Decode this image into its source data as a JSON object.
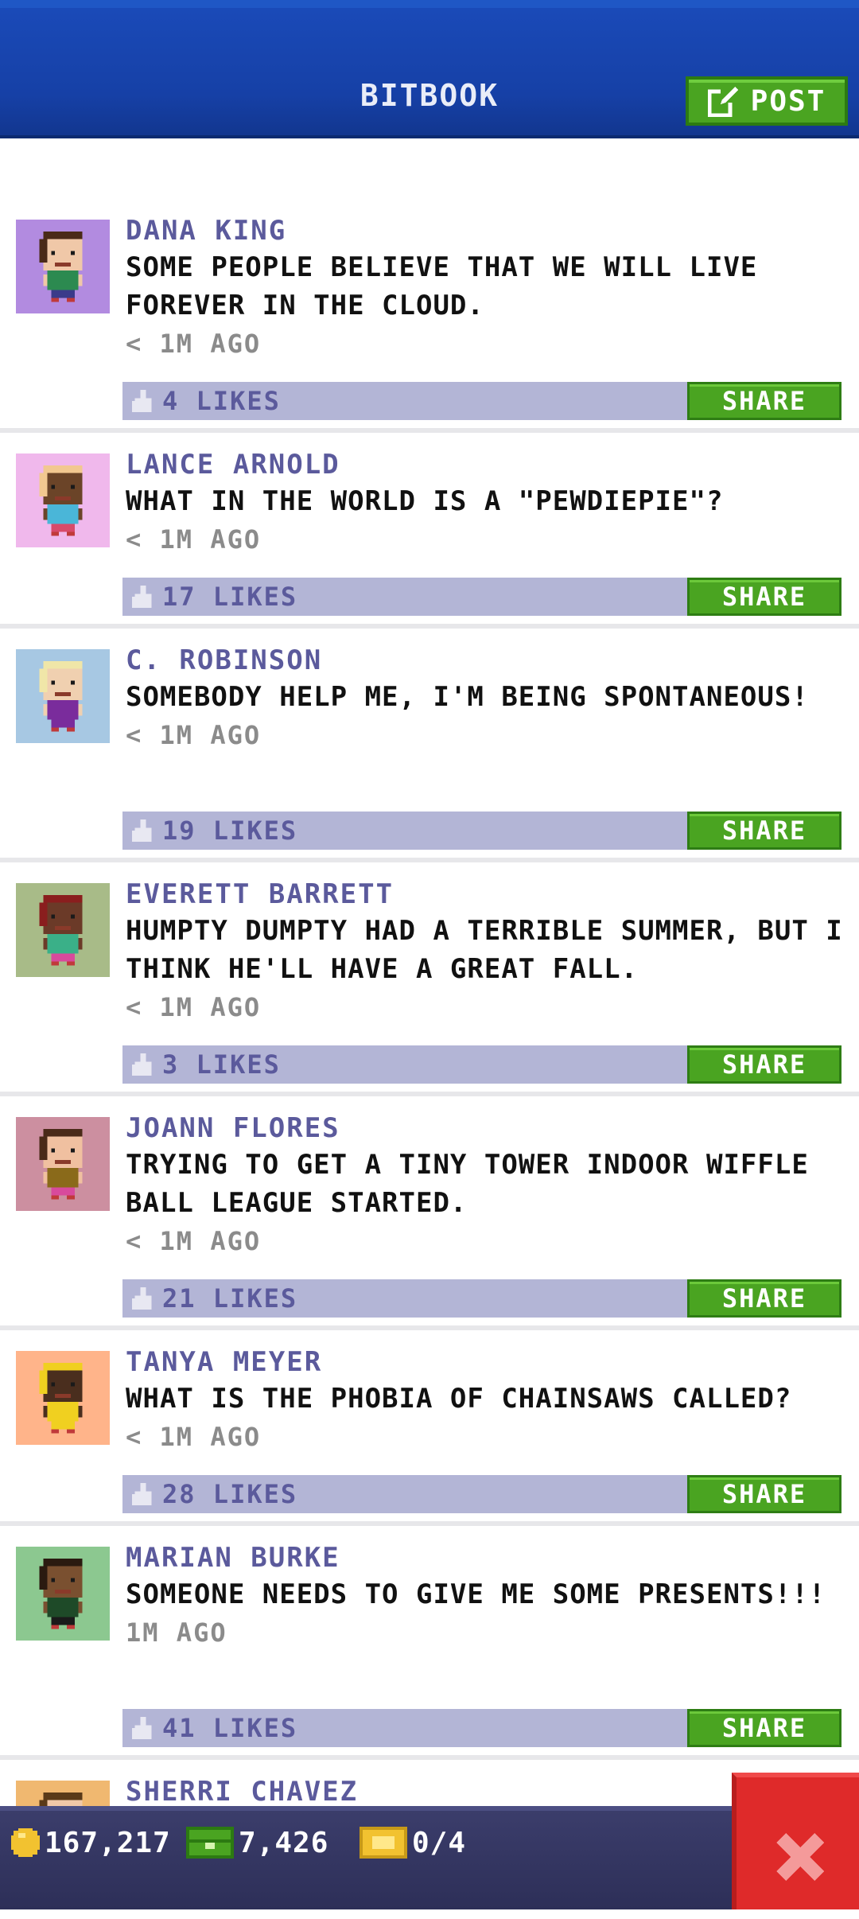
{
  "header": {
    "title": "BITBOOK",
    "post_label": "POST"
  },
  "posts": [
    {
      "author": "DANA KING",
      "text": "SOME PEOPLE BELIEVE THAT WE WILL LIVE FOREVER IN THE CLOUD.",
      "time": "< 1M AGO",
      "likes": "4 LIKES",
      "share": "SHARE",
      "avatar_bg": "#b28be0",
      "skin": "#f0c8a8",
      "hair": "#4a2a18",
      "shirt": "#2c8a50",
      "pants": "#3a3a8a"
    },
    {
      "author": "LANCE ARNOLD",
      "text": "WHAT IN THE WORLD IS A \"PEWDIEPIE\"?",
      "time": "< 1M AGO",
      "likes": "17 LIKES",
      "share": "SHARE",
      "avatar_bg": "#f0b8ec",
      "skin": "#6b4428",
      "hair": "#f2c890",
      "shirt": "#4ab6d8",
      "pants": "#d84a6a"
    },
    {
      "author": "C. ROBINSON",
      "text": "SOMEBODY HELP ME, I'M BEING SPONTANEOUS!",
      "time": "< 1M AGO",
      "likes": "19 LIKES",
      "share": "SHARE",
      "avatar_bg": "#a7c8e3",
      "skin": "#f0d0b0",
      "hair": "#f0e6a8",
      "shirt": "#7a2c9c",
      "pants": "#7a2c9c"
    },
    {
      "author": "EVERETT BARRETT",
      "text": "HUMPTY DUMPTY HAD A TERRIBLE SUMMER, BUT I THINK HE'LL HAVE A GREAT FALL.",
      "time": "< 1M AGO",
      "likes": "3 LIKES",
      "share": "SHARE",
      "avatar_bg": "#a8bb88",
      "skin": "#6b3a28",
      "hair": "#8a1e1e",
      "shirt": "#3ab088",
      "pants": "#d84a9c"
    },
    {
      "author": "JOANN FLORES",
      "text": "TRYING TO GET A TINY TOWER INDOOR WIFFLE BALL LEAGUE STARTED.",
      "time": "< 1M AGO",
      "likes": "21 LIKES",
      "share": "SHARE",
      "avatar_bg": "#cc8fa0",
      "skin": "#f0c0a0",
      "hair": "#4a2a18",
      "shirt": "#8a6a1a",
      "pants": "#d84a9c"
    },
    {
      "author": "TANYA MEYER",
      "text": "WHAT IS THE PHOBIA OF CHAINSAWS CALLED?",
      "time": "< 1M AGO",
      "likes": "28 LIKES",
      "share": "SHARE",
      "avatar_bg": "#ffb48a",
      "skin": "#4a2e1e",
      "hair": "#f0d020",
      "shirt": "#f0d020",
      "pants": "#f0d020"
    },
    {
      "author": "MARIAN BURKE",
      "text": "SOMEONE NEEDS TO GIVE ME SOME PRESENTS!!!",
      "time": "1M AGO",
      "likes": "41 LIKES",
      "share": "SHARE",
      "avatar_bg": "#8cc890",
      "skin": "#7a5030",
      "hair": "#2a1a10",
      "shirt": "#1e4a28",
      "pants": "#1a1a1a"
    },
    {
      "author": "SHERRI CHAVEZ",
      "text": "",
      "time": "",
      "likes": "",
      "share": "",
      "avatar_bg": "#f0b870",
      "skin": "#f0c8a8",
      "hair": "#5a3a18",
      "shirt": "#2c8a50",
      "pants": "#3a3a8a"
    }
  ],
  "status_bar": {
    "coins": "167,217",
    "bux": "7,426",
    "tickets": "0/4"
  },
  "colors": {
    "header_blue": "#1a4ab8",
    "accent_green": "#4aa421",
    "like_bar": "#b3b5d6",
    "author_purple": "#5b5a9c",
    "close_red": "#df2a2a",
    "coin_gold": "#f2c230",
    "bux_green": "#3a9a2a"
  },
  "icons": {
    "post": "edit-icon",
    "like": "thumbs-up-icon",
    "coins": "coin-icon",
    "bux": "bux-icon",
    "tickets": "ticket-icon",
    "close": "close-icon"
  }
}
